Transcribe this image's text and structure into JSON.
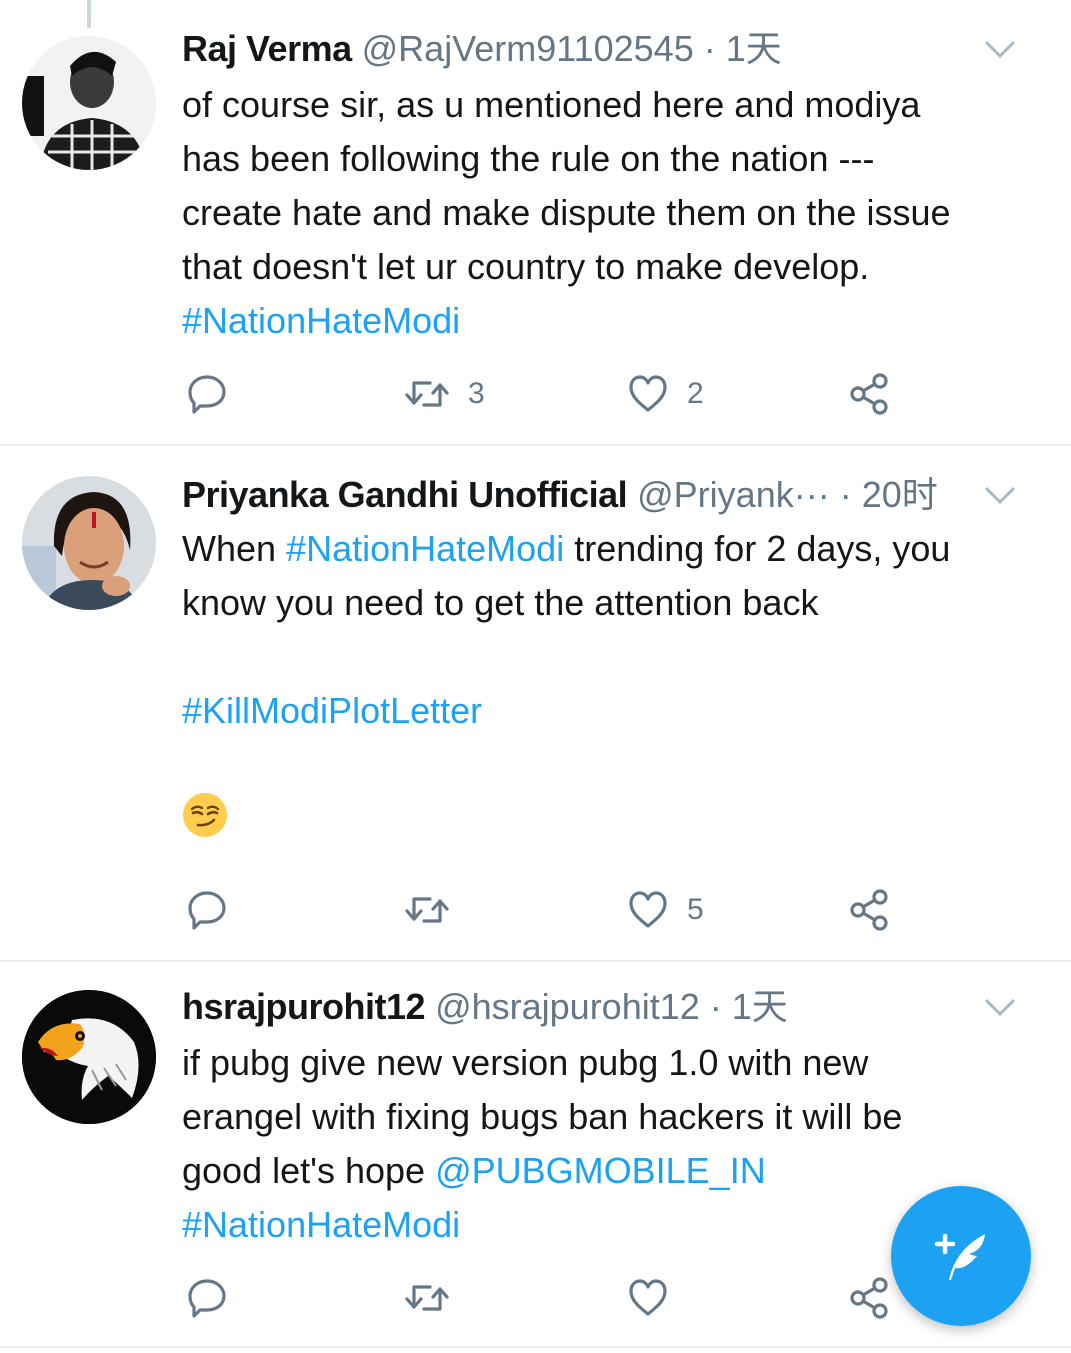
{
  "colors": {
    "accent": "#1da1f2",
    "muted": "#657786",
    "text": "#14171a",
    "divider": "#e6ecf0"
  },
  "tweets": [
    {
      "name": "Raj  Verma",
      "handle": "@RajVerm91102545",
      "separator": " · ",
      "time": "1天",
      "lines": [
        "of course sir, as u mentioned here  and modiya",
        "has been following the rule on the nation ---",
        "create hate and make dispute them on the issue",
        "that doesn't let ur country to make develop."
      ],
      "hashtag": "#NationHateModi",
      "retweets": "3",
      "likes": "2"
    },
    {
      "name": "Priyanka Gandhi Unofficial",
      "handle": "@Priyank···",
      "separator": " · ",
      "time": "20时",
      "text_pre": "When ",
      "hashtag": "#NationHateModi",
      "text_post": " trending for 2 days, you",
      "line2": "know you need to get the attention back",
      "hashtag2": "#KillModiPlotLetter",
      "emoji": "smirking-face",
      "likes": "5"
    },
    {
      "name": "hsrajpurohit12",
      "handle": "@hsrajpurohit12",
      "separator": " · ",
      "time": "1天",
      "lines": [
        "if pubg give new version pubg 1.0 with new",
        "erangel with fixing bugs ban hackers it will be"
      ],
      "line3_pre": "good let's hope ",
      "mention": "@PUBGMOBILE_IN",
      "hashtag": "#NationHateModi"
    }
  ],
  "icons": [
    "reply-icon",
    "retweet-icon",
    "like-icon",
    "share-icon",
    "chevron-down-icon",
    "compose-icon"
  ]
}
